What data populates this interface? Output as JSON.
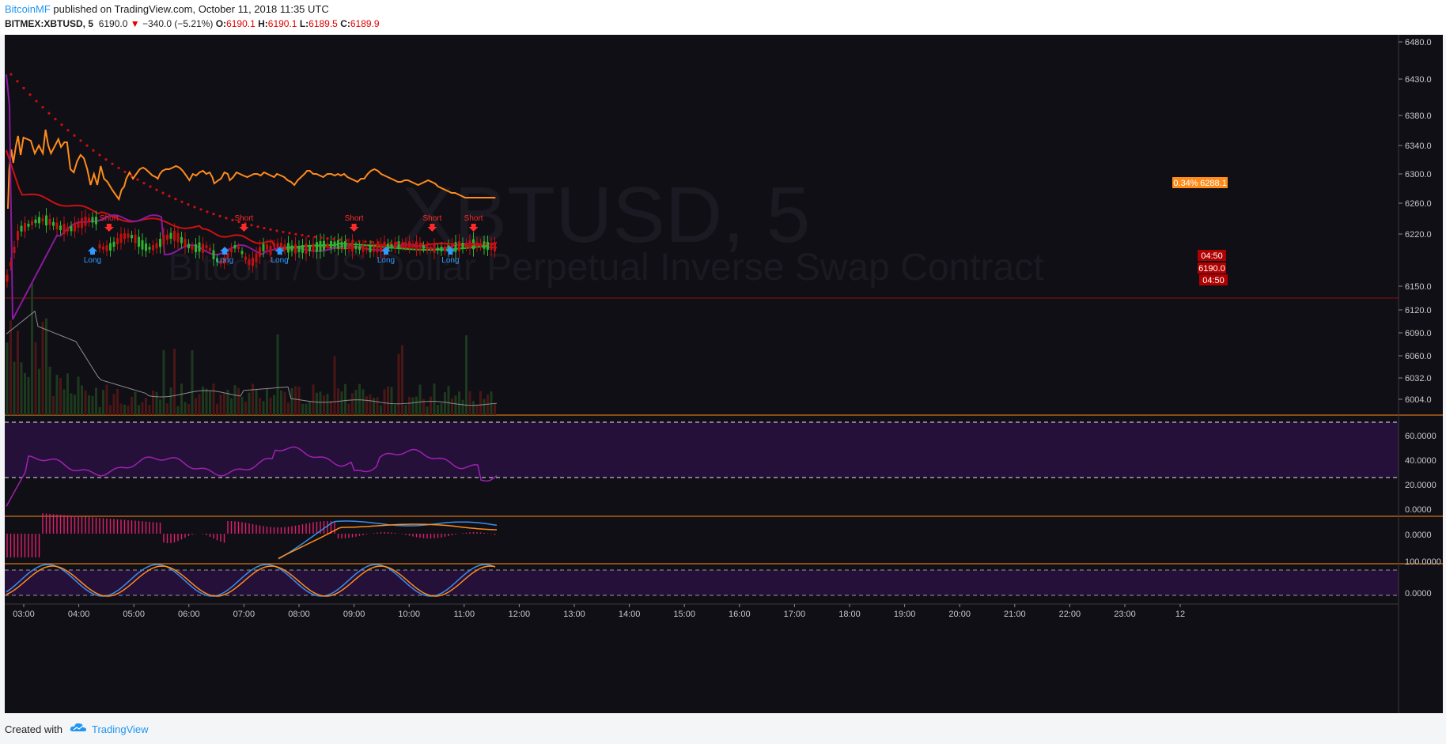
{
  "header": {
    "author": "BitcoinMF",
    "published_text": " published on TradingView.com, October 11, 2018 11:35 UTC",
    "symbol": "BITMEX:XBTUSD, 5",
    "last": "6190.0",
    "change_arrow": "▼",
    "change": "−340.0 (−5.21%)",
    "o_label": "O:",
    "o_value": "6190.1",
    "h_label": "H:",
    "h_value": "6190.1",
    "l_label": "L:",
    "l_value": "6189.5",
    "c_label": "C:",
    "c_value": "6189.9"
  },
  "watermark": {
    "symbol": "XBTUSD, 5",
    "description": "Bitcoin / US Dollar Perpetual Inverse Swap Contract"
  },
  "price_axis": [
    "6480.0",
    "6430.0",
    "6380.0",
    "6340.0",
    "6300.0",
    "6260.0",
    "6220.0",
    "6150.0",
    "6120.0",
    "6090.0",
    "6060.0",
    "6032.0",
    "6004.0"
  ],
  "badges": {
    "orange_pct": "0.34%",
    "orange_price": "6288.1",
    "time_top": "04:50",
    "last_price": "6190.0",
    "time_bottom": "04:50"
  },
  "rsi_axis": [
    "60.0000",
    "40.0000",
    "20.0000",
    "0.0000"
  ],
  "macd_axis": [
    "0.0000"
  ],
  "stoch_axis": [
    "100.0000",
    "0.0000"
  ],
  "time_axis": [
    "03:00",
    "04:00",
    "05:00",
    "06:00",
    "07:00",
    "08:00",
    "09:00",
    "10:00",
    "11:00",
    "12:00",
    "13:00",
    "14:00",
    "15:00",
    "16:00",
    "17:00",
    "18:00",
    "19:00",
    "20:00",
    "21:00",
    "22:00",
    "23:00",
    "12"
  ],
  "signals": {
    "shorts": [
      {
        "label": "Short",
        "hour": 4.55
      },
      {
        "label": "Short",
        "hour": 7.0
      },
      {
        "label": "Short",
        "hour": 9.0
      },
      {
        "label": "Short",
        "hour": 10.42
      },
      {
        "label": "Short",
        "hour": 11.17
      }
    ],
    "longs": [
      {
        "label": "Long",
        "hour": 4.25
      },
      {
        "label": "Long",
        "hour": 6.65
      },
      {
        "label": "Long",
        "hour": 7.65
      },
      {
        "label": "Long",
        "hour": 9.58
      },
      {
        "label": "Long",
        "hour": 10.75
      }
    ]
  },
  "footer": {
    "created_with": "Created with",
    "brand": "TradingView"
  },
  "colors": {
    "background": "#100f16",
    "orange": "#ff8c1a",
    "red": "#cc1010",
    "purple": "#8a1a9e",
    "green": "#2db52d",
    "volume_up": "#1d3a1d",
    "volume_down": "#4a1616",
    "gray": "#8c8c8c",
    "rsi_band": "#25103a",
    "macd_hist": "#e0206e",
    "blue": "#3a8fe8"
  }
}
